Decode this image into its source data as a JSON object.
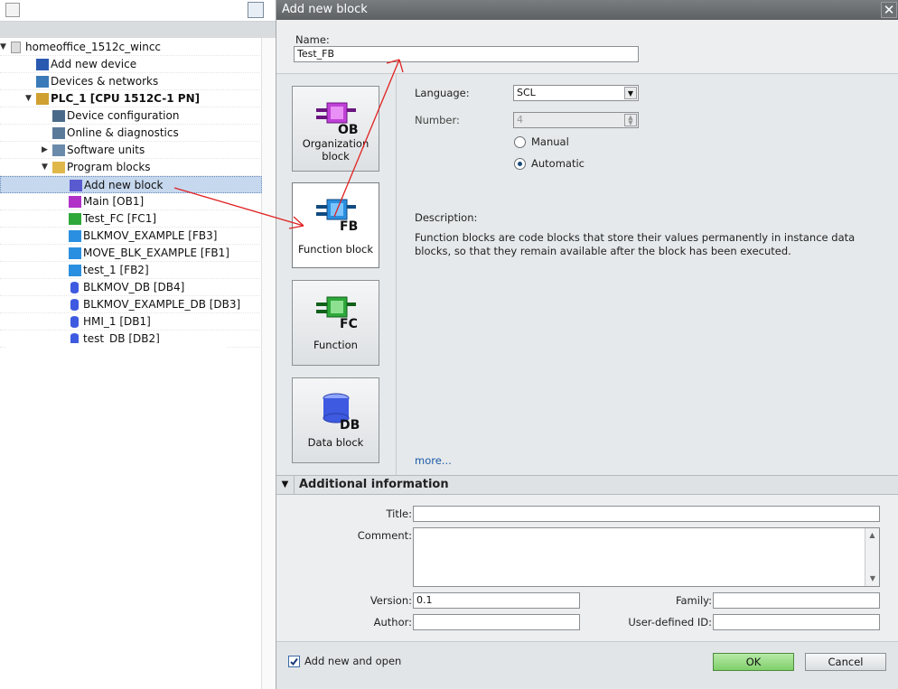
{
  "tree": {
    "items": [
      {
        "label": "homeoffice_1512c_wincc",
        "bold": false
      },
      {
        "label": "Add new device",
        "bold": false
      },
      {
        "label": "Devices & networks",
        "bold": false
      },
      {
        "label": "PLC_1 [CPU 1512C-1 PN]",
        "bold": true
      },
      {
        "label": "Device configuration",
        "bold": false
      },
      {
        "label": "Online & diagnostics",
        "bold": false
      },
      {
        "label": "Software units",
        "bold": false
      },
      {
        "label": "Program blocks",
        "bold": false
      },
      {
        "label": "Add new block",
        "bold": false
      },
      {
        "label": "Main [OB1]",
        "bold": false
      },
      {
        "label": "Test_FC [FC1]",
        "bold": false
      },
      {
        "label": "BLKMOV_EXAMPLE [FB3]",
        "bold": false
      },
      {
        "label": "MOVE_BLK_EXAMPLE [FB1]",
        "bold": false
      },
      {
        "label": "test_1 [FB2]",
        "bold": false
      },
      {
        "label": "BLKMOV_DB [DB4]",
        "bold": false
      },
      {
        "label": "BLKMOV_EXAMPLE_DB [DB3]",
        "bold": false
      },
      {
        "label": "HMI_1 [DB1]",
        "bold": false
      },
      {
        "label": "test_DB [DB2]",
        "bold": false
      }
    ]
  },
  "dialog": {
    "title": "Add new block",
    "close_glyph": "✕",
    "name_label": "Name:",
    "name_value": "Test_FB",
    "blocks": [
      {
        "tag": "OB",
        "label": "Organization block",
        "color": "#b030c8"
      },
      {
        "tag": "FB",
        "label": "Function block",
        "color": "#2a8fe0"
      },
      {
        "tag": "FC",
        "label": "Function",
        "color": "#2ea83a"
      },
      {
        "tag": "DB",
        "label": "Data block",
        "color": "#3d5ae0"
      }
    ],
    "language_label": "Language:",
    "language_value": "SCL",
    "number_label": "Number:",
    "number_value": "4",
    "manual_label": "Manual",
    "automatic_label": "Automatic",
    "description_label": "Description:",
    "description_text": "Function blocks are code blocks that store their values permanently in instance data blocks, so that they remain available after the block has been executed.",
    "more_link": "more...",
    "additional_info_label": "Additional information",
    "title_label": "Title:",
    "comment_label": "Comment:",
    "version_label": "Version:",
    "version_value": "0.1",
    "family_label": "Family:",
    "author_label": "Author:",
    "user_defined_id_label": "User-defined ID:",
    "add_new_and_open_label": "Add new and open",
    "ok_label": "OK",
    "cancel_label": "Cancel"
  },
  "colors": {
    "annotation_arrow": "#e02020",
    "ok_button": "#8fd67a",
    "selection": "#c6d8ee"
  }
}
